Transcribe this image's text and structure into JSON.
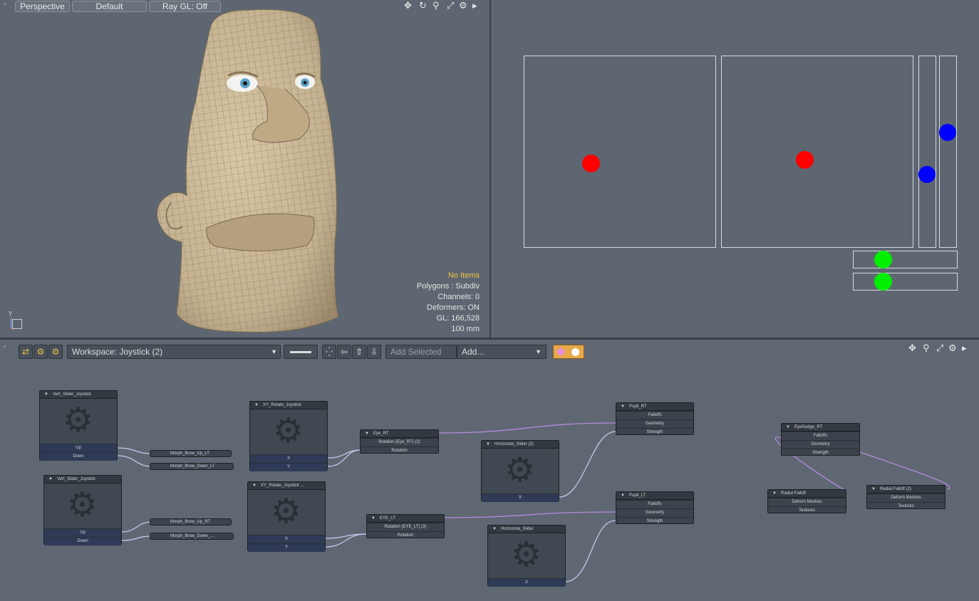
{
  "viewport_left": {
    "buttons": [
      "Perspective",
      "Default",
      "Ray GL: Off"
    ],
    "tools": {
      "move": "✥",
      "rotate": "↻",
      "zoom": "⚲",
      "maximize": "⤢",
      "settings": "⚙",
      "more": "▸"
    },
    "info": {
      "selection": "No Items",
      "polygons": "Polygons : Subdiv",
      "channels": "Channels: 0",
      "deformers": "Deformers: ON",
      "gl": "GL: 166,528",
      "scale": "100 mm"
    },
    "axis_label": "Y",
    "mesh_color": "#c4b190",
    "selection_color": "#f5c242"
  },
  "viewport_right": {
    "dot_colors": {
      "red": "#ff0000",
      "blue": "#0000ff",
      "green": "#00ee00"
    }
  },
  "schematic": {
    "workspace": "Workspace: Joystick (2)",
    "add_selected": "Add Selected",
    "add_dropdown": "Add...",
    "nodes": {
      "vert1": {
        "title": "Vert_Slider_Joystick",
        "out1": "Up",
        "out2": "Down"
      },
      "vert2": {
        "title": "Vert_Slider_Joystick",
        "out1": "Up",
        "out2": "Down"
      },
      "xy1": {
        "title": "XY_Rotate_Joystick",
        "out1": "X",
        "out2": "Y"
      },
      "xy2": {
        "title": "XY_Rotate_Joystick ...",
        "out1": "X",
        "out2": "Y"
      },
      "eye_rt": {
        "title": "Eye_RT",
        "row": "Rotation (Eye_RT) (2)",
        "sub": "Rotation"
      },
      "eye_lt": {
        "title": "EYE_LT",
        "row": "Rotation (EYE_LT) (3)",
        "sub": "Rotation"
      },
      "hs1": {
        "title": "Horizontal_Slider (2)",
        "out": "X"
      },
      "hs2": {
        "title": "Horizontal_Slider",
        "out": "X"
      },
      "pupil_rt": {
        "title": "Pupil_RT",
        "rows": [
          "Falloffs",
          "Geometry",
          "Strength"
        ]
      },
      "pupil_lt": {
        "title": "Pupil_LT",
        "rows": [
          "Falloffs",
          "Geometry",
          "Strength"
        ]
      },
      "eyenudge": {
        "title": "EyeNudge_RT",
        "rows": [
          "Falloffs",
          "Geometry",
          "Strength"
        ]
      },
      "radial1": {
        "title": "Radial Falloff",
        "rows": [
          "Deform Meshes",
          "Textures"
        ]
      },
      "radial2": {
        "title": "Radial Falloff (2)",
        "rows": [
          "Deform Meshes",
          "Textures"
        ]
      },
      "m1": "Morph_Brow_Up_LT",
      "m2": "Morph_Brow_Down_LT",
      "m3": "Morph_Brow_Up_RT",
      "m4": "Morph_Brow_Down_..."
    },
    "wire_color": "#c9c4ec",
    "link_color": "#b68ae0",
    "key_color": "#e6a94a"
  }
}
